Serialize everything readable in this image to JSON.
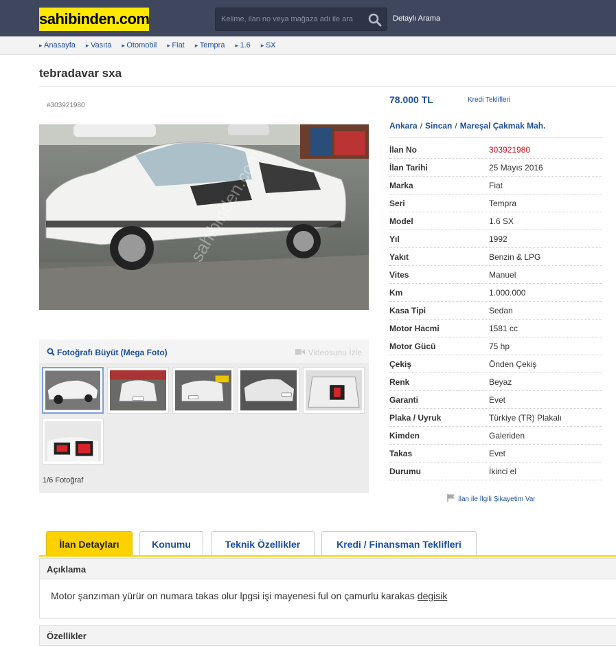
{
  "header": {
    "logo": "sahibinden.com",
    "search_placeholder": "Kelime, ilan no veya mağaza adı ile ara",
    "advanced_search": "Detaylı Arama"
  },
  "breadcrumb": [
    "Anasayfa",
    "Vasıta",
    "Otomobil",
    "Fiat",
    "Tempra",
    "1.6",
    "SX"
  ],
  "listing": {
    "title": "tebradavar sxa",
    "ad_number": "#303921980",
    "price": "78.000 TL",
    "credit_link": "Kredi Teklifleri",
    "location": [
      "Ankara",
      "Sincan",
      "Mareşal Çakmak Mah."
    ],
    "location_sep": "/"
  },
  "gallery": {
    "mega_photo": "Fotoğrafı Büyüt (Mega Foto)",
    "video": "Videosunu İzle",
    "count": "1/6 Fotoğraf",
    "watermark": "sahibinden.com"
  },
  "specs": [
    {
      "k": "İlan No",
      "v": "303921980"
    },
    {
      "k": "İlan Tarihi",
      "v": "25 Mayıs 2016"
    },
    {
      "k": "Marka",
      "v": "Fiat"
    },
    {
      "k": "Seri",
      "v": "Tempra"
    },
    {
      "k": "Model",
      "v": "1.6 SX"
    },
    {
      "k": "Yıl",
      "v": "1992"
    },
    {
      "k": "Yakıt",
      "v": "Benzin & LPG"
    },
    {
      "k": "Vites",
      "v": "Manuel"
    },
    {
      "k": "Km",
      "v": "1.000.000"
    },
    {
      "k": "Kasa Tipi",
      "v": "Sedan"
    },
    {
      "k": "Motor Hacmi",
      "v": "1581 cc"
    },
    {
      "k": "Motor Gücü",
      "v": "75 hp"
    },
    {
      "k": "Çekiş",
      "v": "Önden Çekiş"
    },
    {
      "k": "Renk",
      "v": "Beyaz"
    },
    {
      "k": "Garanti",
      "v": "Evet"
    },
    {
      "k": "Plaka / Uyruk",
      "v": "Türkiye (TR) Plakalı"
    },
    {
      "k": "Kimden",
      "v": "Galeriden"
    },
    {
      "k": "Takas",
      "v": "Evet"
    },
    {
      "k": "Durumu",
      "v": "İkinci el"
    }
  ],
  "complaint": "İlan ile İlgili Şikayetim Var",
  "tabs": [
    "İlan Detayları",
    "Konumu",
    "Teknik Özellikler",
    "Kredi / Finansman Teklifleri"
  ],
  "description": {
    "heading": "Açıklama",
    "text": "Motor şanzıman yürür on numara takas olur lpgsi işi  mayenesi ful on çamurlu karakas ",
    "underlined": "degisik"
  },
  "features_heading": "Özellikler",
  "colors": {
    "header_bg": "#3f475f",
    "logo_bg": "#ffe800",
    "link": "#1b4e9e",
    "ad_no_red": "#c4161c",
    "tab_active": "#fbd100"
  }
}
